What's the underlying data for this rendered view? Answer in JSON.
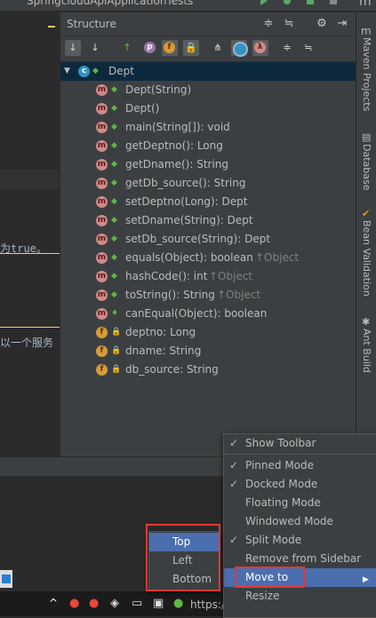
{
  "titlebar": {
    "tab": "SpringcloudApiApplicationTests"
  },
  "editor": {
    "snippet1": "为true。",
    "snippet2": "以一个服务"
  },
  "structure": {
    "title": "Structure",
    "class_name": "Dept",
    "members": [
      {
        "icon": "m",
        "vis": "public",
        "text": "Dept(String)",
        "sub": ""
      },
      {
        "icon": "m",
        "vis": "public",
        "text": "Dept()",
        "sub": ""
      },
      {
        "icon": "m",
        "vis": "public",
        "text": "main(String[]): void",
        "sub": ""
      },
      {
        "icon": "m",
        "vis": "public",
        "text": "getDeptno(): Long",
        "sub": ""
      },
      {
        "icon": "m",
        "vis": "public",
        "text": "getDname(): String",
        "sub": ""
      },
      {
        "icon": "m",
        "vis": "public",
        "text": "getDb_source(): String",
        "sub": ""
      },
      {
        "icon": "m",
        "vis": "public",
        "text": "setDeptno(Long): Dept",
        "sub": ""
      },
      {
        "icon": "m",
        "vis": "public",
        "text": "setDname(String): Dept",
        "sub": ""
      },
      {
        "icon": "m",
        "vis": "public",
        "text": "setDb_source(String): Dept",
        "sub": ""
      },
      {
        "icon": "m",
        "vis": "public",
        "text": "equals(Object): boolean ",
        "sub": "↑Object"
      },
      {
        "icon": "m",
        "vis": "public",
        "text": "hashCode(): int ",
        "sub": "↑Object"
      },
      {
        "icon": "m",
        "vis": "public",
        "text": "toString(): String ",
        "sub": "↑Object"
      },
      {
        "icon": "m",
        "vis": "protected",
        "text": "canEqual(Object): boolean",
        "sub": ""
      },
      {
        "icon": "f",
        "vis": "private",
        "text": "deptno: Long",
        "sub": ""
      },
      {
        "icon": "f",
        "vis": "private",
        "text": "dname: String",
        "sub": ""
      },
      {
        "icon": "f",
        "vis": "private",
        "text": "db_source: String",
        "sub": ""
      }
    ]
  },
  "right_stripe": {
    "items": [
      "Maven Projects",
      "Database",
      "Bean Validation",
      "Ant Build"
    ]
  },
  "main_menu": {
    "items": [
      {
        "check": "✓",
        "label": "Show Toolbar"
      },
      {
        "check": "✓",
        "label": "Pinned Mode"
      },
      {
        "check": "✓",
        "label": "Docked Mode"
      },
      {
        "check": "",
        "label": "Floating Mode"
      },
      {
        "check": "",
        "label": "Windowed Mode"
      },
      {
        "check": "✓",
        "label": "Split Mode"
      },
      {
        "check": "",
        "label": "Remove from Sidebar"
      },
      {
        "check": "",
        "label": "Move to"
      },
      {
        "check": "",
        "label": "Resize"
      }
    ],
    "submenu_arrow": "▶"
  },
  "sub_menu": {
    "items": [
      "Top",
      "Left",
      "Bottom"
    ]
  },
  "watermark": "https://www.xz.blog.csdn.net",
  "colors": {
    "highlight": "#4b6eaf",
    "red_box": "#e53935",
    "panel_bg": "#3c3f41",
    "editor_bg": "#2b2b2b"
  }
}
